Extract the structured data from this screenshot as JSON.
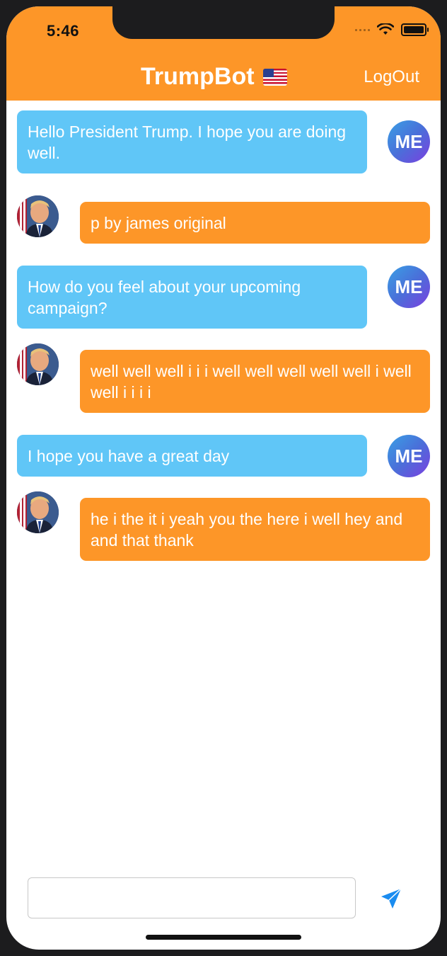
{
  "status_bar": {
    "time": "5:46"
  },
  "header": {
    "title": "TrumpBot",
    "logout_label": "LogOut"
  },
  "me_avatar_label": "ME",
  "messages": [
    {
      "sender": "me",
      "text": "Hello President Trump. I hope you are doing well."
    },
    {
      "sender": "bot",
      "text": "p by james original"
    },
    {
      "sender": "me",
      "text": "How do you feel about your upcoming campaign?"
    },
    {
      "sender": "bot",
      "text": "well well well i i i well well well well well i well well i i i i"
    },
    {
      "sender": "me",
      "text": "I hope you have a great day"
    },
    {
      "sender": "bot",
      "text": "he i the it i yeah you the here i well hey and and that thank"
    }
  ],
  "composer": {
    "input_value": "",
    "placeholder": ""
  },
  "colors": {
    "header": "#fd9628",
    "me_bubble": "#60c6f7",
    "bot_bubble": "#fd9628"
  }
}
